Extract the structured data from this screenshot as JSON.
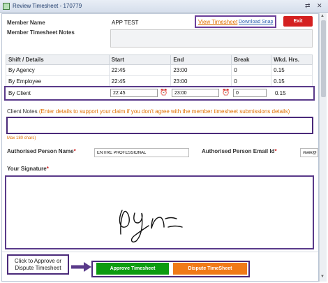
{
  "window": {
    "title": "Review Timesheet - 170779",
    "icon": "sheet-icon"
  },
  "header": {
    "member_name_label": "Member Name",
    "member_name_value": "APP TEST",
    "notes_label": "Member Timesheet Notes",
    "view_link": "View Timesheet",
    "download_link": "Download Snap",
    "exit_label": "Exit"
  },
  "table": {
    "headers": [
      "Shift / Details",
      "Start",
      "End",
      "Break",
      "Wkd. Hrs."
    ],
    "rows": [
      [
        "By Agency",
        "22:45",
        "23:00",
        "0",
        "0.15"
      ],
      [
        "By Employee",
        "22:45",
        "23:00",
        "0",
        "0.15"
      ]
    ],
    "client": {
      "label": "By Client",
      "start": "22:45",
      "end": "23:00",
      "break": "0",
      "hours": "0.15"
    }
  },
  "client_notes": {
    "label": "Client Notes",
    "hint": "(Enter details to support your claim if you don't agree with the member timesheet submissions details)",
    "max": "Max 180 chars)"
  },
  "authorised": {
    "name_label": "Authorised Person Name",
    "name_value": "ENTIRE PROFESSIONAL",
    "email_label": "Authorised Person Email Id",
    "email_value": "vivek@"
  },
  "signature": {
    "label": "Your Signature"
  },
  "footer": {
    "callout": "Click to Approve or Dispute Timesheet",
    "approve": "Approve Timesheet",
    "dispute": "Dispute TimeSheet"
  },
  "colors": {
    "exit": "#d42020",
    "approve": "#0d9b10",
    "dispute": "#f07a18",
    "highlight": "#5a3a8a",
    "hint": "#e07000"
  }
}
